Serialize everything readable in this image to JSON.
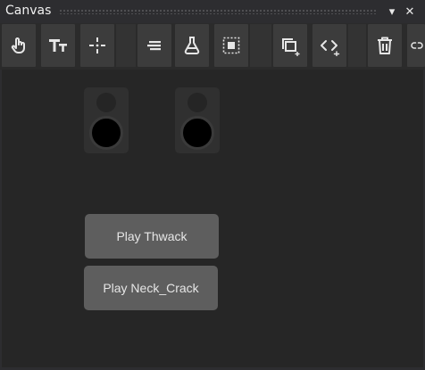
{
  "window": {
    "title": "Canvas",
    "dropdown_glyph": "▾",
    "close_glyph": "✕"
  },
  "toolbar": {
    "tools": [
      {
        "name": "touch-icon"
      },
      {
        "name": "text-icon"
      },
      {
        "name": "move-icon"
      },
      {
        "name": "align-icon"
      },
      {
        "name": "flask-icon"
      },
      {
        "name": "select-region-icon"
      },
      {
        "name": "add-layer-icon"
      },
      {
        "name": "add-code-icon"
      },
      {
        "name": "trash-icon"
      },
      {
        "name": "link-icon"
      }
    ]
  },
  "canvas": {
    "buttons": {
      "play_thwack": "Play Thwack",
      "play_neck_crack": "Play Neck_Crack"
    }
  },
  "colors": {
    "background": "#262626",
    "button": "#5e5e5e",
    "toolbar_button": "#3c3c3c"
  }
}
